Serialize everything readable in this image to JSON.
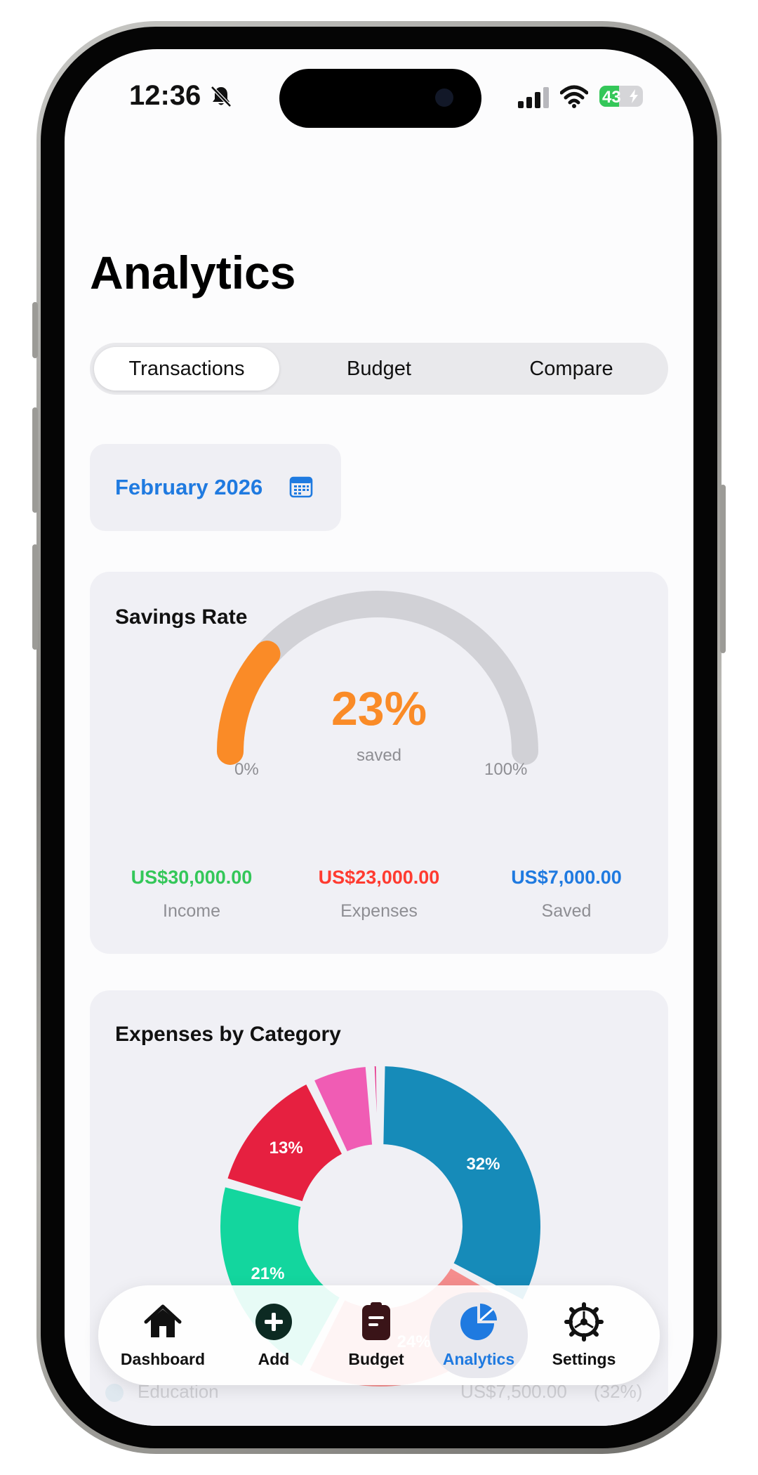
{
  "status_bar": {
    "time": "12:36",
    "battery": "43"
  },
  "page_title": "Analytics",
  "segments": [
    {
      "label": "Transactions",
      "active": true
    },
    {
      "label": "Budget",
      "active": false
    },
    {
      "label": "Compare",
      "active": false
    }
  ],
  "month_picker": {
    "label": "February 2026"
  },
  "savings_card": {
    "title": "Savings Rate",
    "percent_label": "23%",
    "percent_value": 23,
    "subtitle": "saved",
    "min_label": "0%",
    "max_label": "100%",
    "stats": [
      {
        "value": "US$30,000.00",
        "label": "Income",
        "color": "#34c759"
      },
      {
        "value": "US$23,000.00",
        "label": "Expenses",
        "color": "#ff3b30"
      },
      {
        "value": "US$7,000.00",
        "label": "Saved",
        "color": "#1f7ae0"
      }
    ]
  },
  "expenses_card": {
    "title": "Expenses by Category"
  },
  "chart_data": {
    "type": "pie",
    "title": "Expenses by Category",
    "slices": [
      {
        "percent": 32,
        "label": "32%",
        "color": "#168bb9"
      },
      {
        "percent": 24,
        "label": "24%",
        "color": "#f58d8d"
      },
      {
        "percent": 21,
        "label": "21%",
        "color": "#13d69e"
      },
      {
        "percent": 13,
        "label": "13%",
        "color": "#e62040"
      },
      {
        "percent": 6,
        "label": "",
        "color": "#f05cb4"
      },
      {
        "percent": 1,
        "label": "",
        "color": "#e5197d"
      }
    ]
  },
  "partial_row": {
    "name": "Education",
    "amount": "US$7,500.00",
    "percent": "(32%)"
  },
  "tab_bar": [
    {
      "label": "Dashboard",
      "icon": "house-icon",
      "active": false
    },
    {
      "label": "Add",
      "icon": "plus-circle-icon",
      "active": false
    },
    {
      "label": "Budget",
      "icon": "clipboard-icon",
      "active": false
    },
    {
      "label": "Analytics",
      "icon": "pie-chart-icon",
      "active": true
    },
    {
      "label": "Settings",
      "icon": "gear-icon",
      "active": false
    }
  ],
  "colors": {
    "accent": "#1f7ae0",
    "gauge_fill": "#fa8b27",
    "gauge_track": "#d1d1d6",
    "card_bg": "#f0f0f5"
  }
}
